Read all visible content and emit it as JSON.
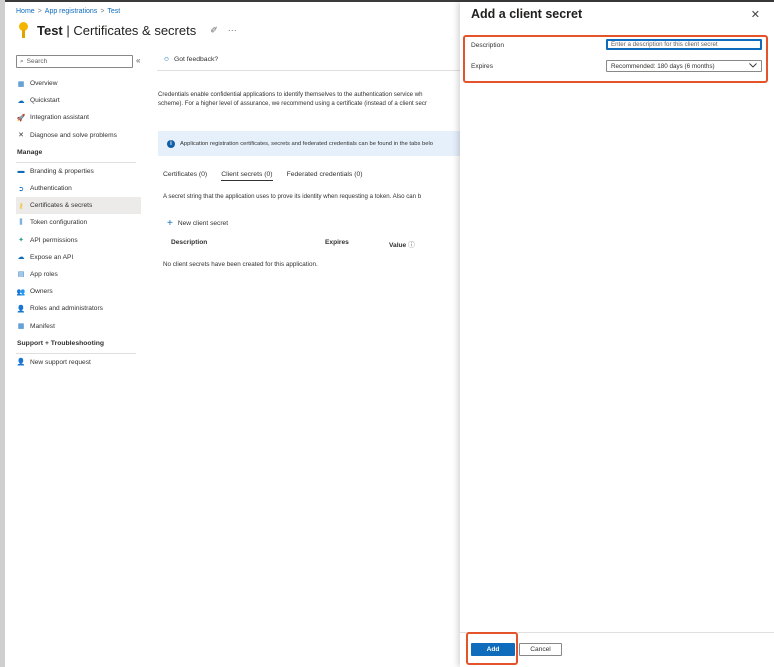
{
  "breadcrumb": [
    "Home",
    "App registrations",
    "Test"
  ],
  "breadcrumb_separator": ">",
  "header": {
    "app_name": "Test",
    "divider": "|",
    "section": "Certificates & secrets",
    "pin": "✐",
    "more": "···"
  },
  "sidebar": {
    "search_placeholder": "Search",
    "collapse_glyph": "«",
    "top_items": [
      {
        "label": "Overview",
        "icon": "overview-icon",
        "glyph": "▦",
        "color": "#0f6cbd"
      },
      {
        "label": "Quickstart",
        "icon": "quickstart-icon",
        "glyph": "☁",
        "color": "#0f6cbd"
      },
      {
        "label": "Integration assistant",
        "icon": "rocket-icon",
        "glyph": "🚀",
        "color": "#d47500"
      },
      {
        "label": "Diagnose and solve problems",
        "icon": "wrench-icon",
        "glyph": "✕",
        "color": "#323130"
      }
    ],
    "manage_heading": "Manage",
    "manage_items": [
      {
        "label": "Branding & properties",
        "icon": "branding-icon",
        "glyph": "▬",
        "color": "#0f6cbd"
      },
      {
        "label": "Authentication",
        "icon": "authentication-icon",
        "glyph": "➲",
        "color": "#0f6cbd"
      },
      {
        "label": "Certificates & secrets",
        "icon": "key-icon",
        "glyph": "⚷",
        "color": "#f2b600",
        "active": true
      },
      {
        "label": "Token configuration",
        "icon": "token-icon",
        "glyph": "⫼",
        "color": "#0f6cbd"
      },
      {
        "label": "API permissions",
        "icon": "api-permissions-icon",
        "glyph": "✦",
        "color": "#2a9d8f"
      },
      {
        "label": "Expose an API",
        "icon": "cloud-icon",
        "glyph": "☁",
        "color": "#0f6cbd"
      },
      {
        "label": "App roles",
        "icon": "app-roles-icon",
        "glyph": "▤",
        "color": "#0f6cbd"
      },
      {
        "label": "Owners",
        "icon": "owners-icon",
        "glyph": "👥",
        "color": "#0f6cbd"
      },
      {
        "label": "Roles and administrators",
        "icon": "roles-icon",
        "glyph": "👤",
        "color": "#4caf50"
      },
      {
        "label": "Manifest",
        "icon": "manifest-icon",
        "glyph": "▦",
        "color": "#0f6cbd"
      }
    ],
    "support_heading": "Support + Troubleshooting",
    "support_items": [
      {
        "label": "New support request",
        "icon": "support-icon",
        "glyph": "👤",
        "color": "#0f6cbd"
      }
    ]
  },
  "main": {
    "feedback_label": "Got feedback?",
    "description_line1": "Credentials enable confidential applications to identify themselves to the authentication service wh",
    "description_line2": "scheme). For a higher level of assurance, we recommend using a certificate (instead of a client secr",
    "info_text": "Application registration certificates, secrets and federated credentials can be found in the tabs belo",
    "info_glyph": "i",
    "tabs": [
      "Certificates (0)",
      "Client secrets (0)",
      "Federated credentials (0)"
    ],
    "secret_description": "A secret string that the application uses to prove its identity when requesting a token. Also can b",
    "new_secret_label": "New client secret",
    "columns": {
      "description": "Description",
      "expires": "Expires",
      "value": "Value"
    },
    "value_info_glyph": "ⓘ",
    "empty_message": "No client secrets have been created for this application."
  },
  "panel": {
    "title": "Add a client secret",
    "close_glyph": "✕",
    "description_label": "Description",
    "description_placeholder": "Enter a description for this client secret",
    "expires_label": "Expires",
    "expires_value": "Recommended: 180 days (6 months)",
    "add_label": "Add",
    "cancel_label": "Cancel"
  },
  "colors": {
    "accent": "#0f6cbd",
    "highlight": "#e4532a",
    "info_bg": "#e6f0fb"
  }
}
